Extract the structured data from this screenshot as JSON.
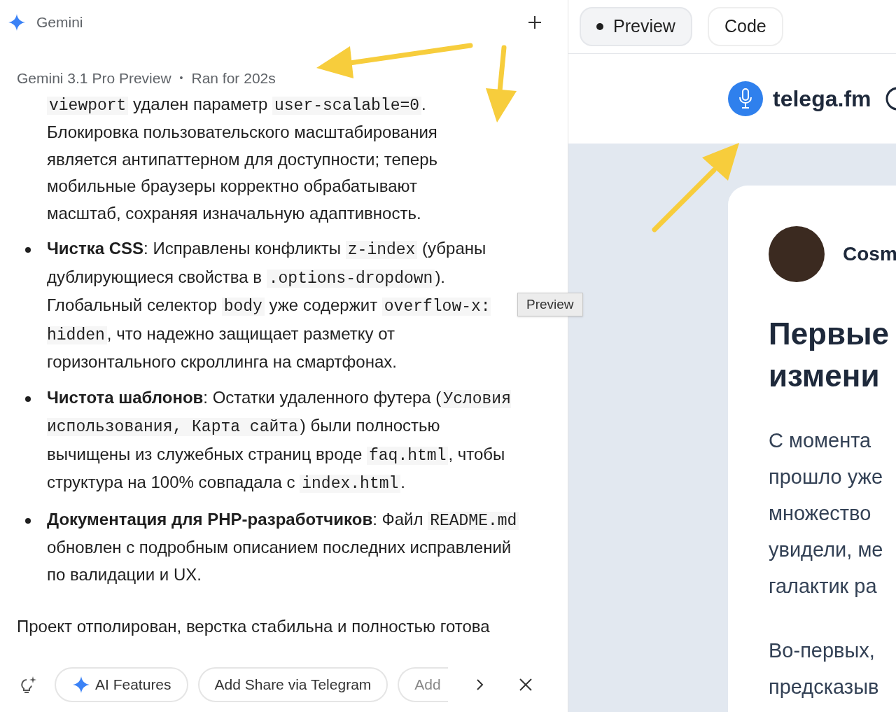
{
  "header": {
    "title": "Gemini"
  },
  "meta": {
    "model": "Gemini 3.1 Pro Preview",
    "separator": "•",
    "duration": "Ran for 202s"
  },
  "content": [
    {
      "kind": "continuation",
      "segments": [
        {
          "kind": "code",
          "text": "viewport"
        },
        {
          "kind": "plain",
          "text": " удален параметр "
        },
        {
          "kind": "code",
          "text": "user-scalable=0"
        },
        {
          "kind": "plain",
          "text": ". Блокировка пользовательского масштабирования является антипаттерном для доступности; теперь мобильные браузеры корректно обрабатывают масштаб, сохраняя изначальную адаптивность."
        }
      ]
    },
    {
      "kind": "bullet",
      "segments": [
        {
          "kind": "bold",
          "text": "Чистка CSS"
        },
        {
          "kind": "plain",
          "text": ": Исправлены конфликты "
        },
        {
          "kind": "code",
          "text": "z-index"
        },
        {
          "kind": "plain",
          "text": " (убраны дублирующиеся свойства в "
        },
        {
          "kind": "code",
          "text": ".options-dropdown"
        },
        {
          "kind": "plain",
          "text": "). Глобальный селектор "
        },
        {
          "kind": "code",
          "text": "body"
        },
        {
          "kind": "plain",
          "text": " уже содержит "
        },
        {
          "kind": "code",
          "text": "overflow-x: hidden"
        },
        {
          "kind": "plain",
          "text": ", что надежно защищает разметку от горизонтального скроллинга на смартфонах."
        }
      ]
    },
    {
      "kind": "bullet",
      "segments": [
        {
          "kind": "bold",
          "text": "Чистота шаблонов"
        },
        {
          "kind": "plain",
          "text": ": Остатки удаленного футера ("
        },
        {
          "kind": "code",
          "text": "Условия использования, Карта сайта"
        },
        {
          "kind": "plain",
          "text": ") были полностью вычищены из служебных страниц вроде "
        },
        {
          "kind": "code",
          "text": "faq.html"
        },
        {
          "kind": "plain",
          "text": ", чтобы структура на 100% совпадала с "
        },
        {
          "kind": "code",
          "text": "index.html"
        },
        {
          "kind": "plain",
          "text": "."
        }
      ]
    },
    {
      "kind": "bullet",
      "segments": [
        {
          "kind": "bold",
          "text": "Документация для PHP-разработчиков"
        },
        {
          "kind": "plain",
          "text": ": Файл "
        },
        {
          "kind": "code",
          "text": "README.md"
        },
        {
          "kind": "plain",
          "text": " обновлен с подробным описанием последних исправлений по валидации и UX."
        }
      ]
    },
    {
      "kind": "paragraph",
      "segments": [
        {
          "kind": "plain",
          "text": "Проект отполирован, верстка стабильна и полностью готова"
        }
      ]
    }
  ],
  "suggestions": [
    {
      "kind": "icon",
      "label": "AI Features"
    },
    {
      "kind": "plain",
      "label": "Add Share via Telegram"
    },
    {
      "kind": "faded",
      "label": "Add"
    }
  ],
  "tooltip": "Preview",
  "view_tabs": [
    {
      "label": "Preview",
      "selected": true
    },
    {
      "label": "Code",
      "selected": false
    }
  ],
  "preview": {
    "site_name": "telega.fm",
    "author": "Cosm",
    "headline": [
      "Первые",
      "измени"
    ],
    "paragraphs": [
      [
        "С момента",
        "прошло уже",
        "множество",
        "увидели, ме",
        "галактик ра"
      ],
      [
        "Во-первых,",
        "предсказыв"
      ]
    ]
  }
}
